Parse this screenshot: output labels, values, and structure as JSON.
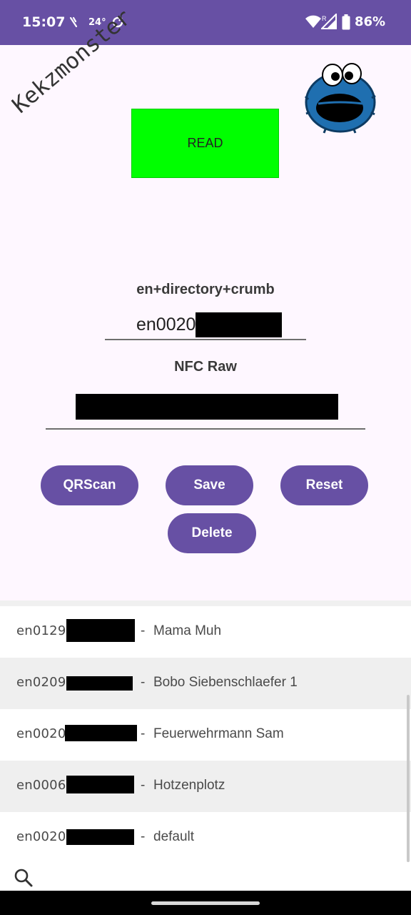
{
  "status_bar": {
    "time": "15:07",
    "temperature": "24°",
    "battery_percent": "86%",
    "background_color": "#6750a4",
    "icons": [
      "notification-icon",
      "sync-icon",
      "wifi-icon",
      "signal-icon",
      "battery-icon"
    ]
  },
  "header": {
    "brand": "Kekzmonster",
    "read_button": "READ",
    "read_button_color": "#00ff00",
    "mascot_icon": "cookie-monster-icon"
  },
  "form": {
    "id_label": "en+directory+crumb",
    "id_value": "en0020",
    "nfc_label": "NFC Raw",
    "nfc_value": ""
  },
  "buttons": {
    "qrscan": "QRScan",
    "save": "Save",
    "reset": "Reset",
    "delete": "Delete",
    "color": "#6750a4"
  },
  "list": {
    "separator": "-",
    "items": [
      {
        "id": "en0129",
        "name": "Mama Muh"
      },
      {
        "id": "en0209",
        "name": "Bobo Siebenschlaefer 1"
      },
      {
        "id": "en0020",
        "name": "Feuerwehrmann Sam"
      },
      {
        "id": "en0006",
        "name": "Hotzenplotz"
      },
      {
        "id": "en0020",
        "name": "default"
      }
    ]
  },
  "search": {
    "icon": "search-icon"
  }
}
